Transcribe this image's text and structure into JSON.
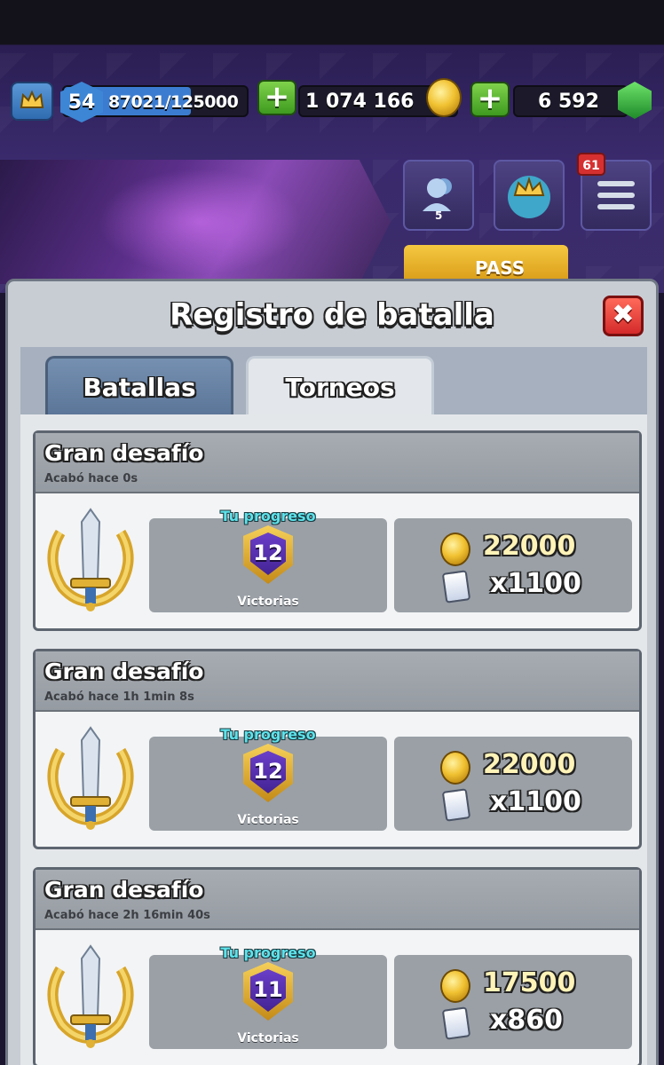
{
  "hud": {
    "level": "54",
    "xp_text": "87021/125000",
    "xp_progress": 0.6962,
    "gold": "1 074 166",
    "gems": "6 592",
    "plus_label": "+"
  },
  "side_buttons": {
    "friends_count": "5",
    "notifications_count": "61",
    "pass_label": "PASS"
  },
  "modal": {
    "title": "Registro de batalla",
    "close_label": "✖",
    "tabs": [
      {
        "label": "Batallas",
        "active": false
      },
      {
        "label": "Torneos",
        "active": true
      }
    ]
  },
  "tournaments": [
    {
      "title": "Gran desafío",
      "ended": "Acabó hace 0s",
      "progress_label": "Tu progreso",
      "wins": "12",
      "wins_label": "Victorias",
      "gold_reward": "22000",
      "cards_reward": "x1100"
    },
    {
      "title": "Gran desafío",
      "ended": "Acabó hace 1h 1min  8s",
      "progress_label": "Tu progreso",
      "wins": "12",
      "wins_label": "Victorias",
      "gold_reward": "22000",
      "cards_reward": "x1100"
    },
    {
      "title": "Gran desafío",
      "ended": "Acabó hace 2h 16min  40s",
      "progress_label": "Tu progreso",
      "wins": "11",
      "wins_label": "Victorias",
      "gold_reward": "17500",
      "cards_reward": "x860"
    }
  ],
  "colors": {
    "accent_cyan": "#5ee2ea",
    "close_red": "#d42a2a",
    "plus_green": "#3e9a1f",
    "gold": "#f1c232"
  }
}
